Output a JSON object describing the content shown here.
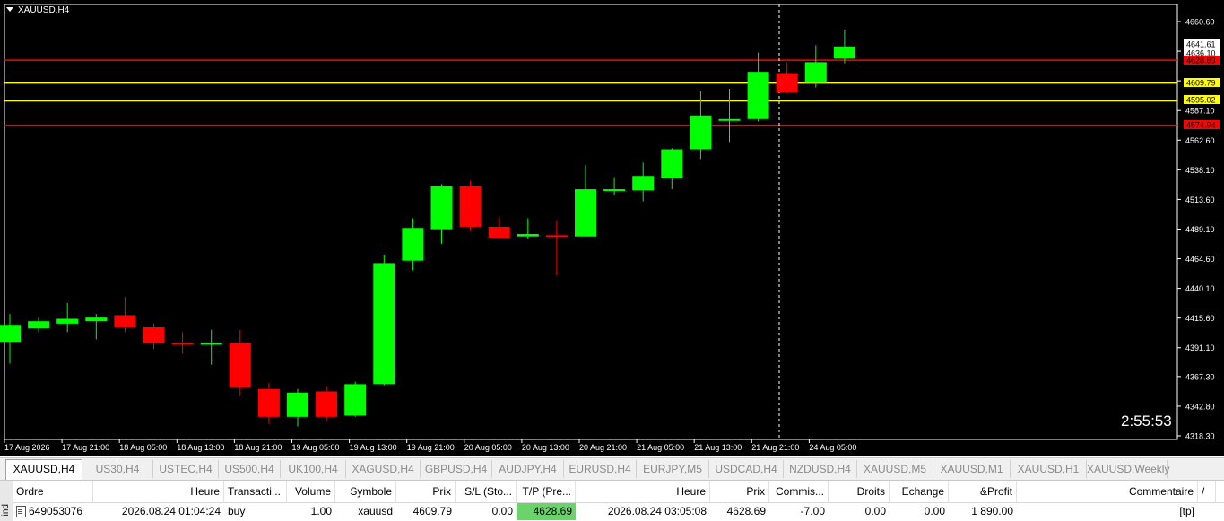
{
  "window": {
    "title": "XAUUSD,H4"
  },
  "chart_data": {
    "type": "candlestick",
    "symbol": "XAUUSD",
    "timeframe": "H4",
    "price_axis": {
      "ticks": [
        "4660.60",
        "4636.10",
        "4611.60",
        "4587.10",
        "4562.60",
        "4538.10",
        "4513.60",
        "4489.10",
        "4464.60",
        "4440.10",
        "4415.60",
        "4391.10",
        "4367.30",
        "4342.80",
        "4318.30"
      ],
      "ylim": [
        4318.3,
        4660.6
      ]
    },
    "time_axis": {
      "labels": [
        "17 Aug 2026",
        "17 Aug 21:00",
        "18 Aug 05:00",
        "18 Aug 13:00",
        "18 Aug 21:00",
        "19 Aug 05:00",
        "19 Aug 13:00",
        "19 Aug 21:00",
        "20 Aug 05:00",
        "20 Aug 13:00",
        "20 Aug 21:00",
        "21 Aug 05:00",
        "21 Aug 13:00",
        "21 Aug 21:00",
        "24 Aug 05:00"
      ]
    },
    "candles": [
      {
        "o": 4396.0,
        "h": 4419.0,
        "l": 4378.0,
        "c": 4410.0
      },
      {
        "o": 4407.0,
        "h": 4416.0,
        "l": 4404.0,
        "c": 4413.0
      },
      {
        "o": 4411.0,
        "h": 4428.0,
        "l": 4404.0,
        "c": 4415.0
      },
      {
        "o": 4413.0,
        "h": 4419.0,
        "l": 4398.0,
        "c": 4416.0
      },
      {
        "o": 4418.0,
        "h": 4433.0,
        "l": 4404.0,
        "c": 4408.0
      },
      {
        "o": 4408.0,
        "h": 4411.0,
        "l": 4390.0,
        "c": 4395.0
      },
      {
        "o": 4395.0,
        "h": 4404.0,
        "l": 4386.0,
        "c": 4394.0
      },
      {
        "o": 4394.0,
        "h": 4406.0,
        "l": 4377.0,
        "c": 4395.0
      },
      {
        "o": 4395.0,
        "h": 4406.0,
        "l": 4351.0,
        "c": 4358.0
      },
      {
        "o": 4357.0,
        "h": 4362.0,
        "l": 4328.0,
        "c": 4334.0
      },
      {
        "o": 4334.0,
        "h": 4357.0,
        "l": 4326.0,
        "c": 4354.0
      },
      {
        "o": 4355.0,
        "h": 4359.0,
        "l": 4331.0,
        "c": 4334.0
      },
      {
        "o": 4335.0,
        "h": 4363.0,
        "l": 4334.0,
        "c": 4361.0
      },
      {
        "o": 4361.0,
        "h": 4468.0,
        "l": 4360.0,
        "c": 4461.0
      },
      {
        "o": 4463.0,
        "h": 4498.0,
        "l": 4455.0,
        "c": 4490.0
      },
      {
        "o": 4489.0,
        "h": 4526.0,
        "l": 4477.0,
        "c": 4525.0
      },
      {
        "o": 4525.0,
        "h": 4529.0,
        "l": 4488.0,
        "c": 4491.0
      },
      {
        "o": 4491.0,
        "h": 4499.0,
        "l": 4482.0,
        "c": 4482.0
      },
      {
        "o": 4483.0,
        "h": 4498.0,
        "l": 4481.0,
        "c": 4485.0
      },
      {
        "o": 4484.0,
        "h": 4496.0,
        "l": 4451.0,
        "c": 4483.0
      },
      {
        "o": 4483.0,
        "h": 4542.0,
        "l": 4483.0,
        "c": 4522.0
      },
      {
        "o": 4522.0,
        "h": 4532.0,
        "l": 4517.0,
        "c": 4522.0
      },
      {
        "o": 4521.0,
        "h": 4544.0,
        "l": 4512.0,
        "c": 4533.0
      },
      {
        "o": 4531.0,
        "h": 4556.0,
        "l": 4522.0,
        "c": 4555.0
      },
      {
        "o": 4555.0,
        "h": 4603.0,
        "l": 4547.0,
        "c": 4583.0
      },
      {
        "o": 4580.0,
        "h": 4605.0,
        "l": 4561.0,
        "c": 4580.0
      },
      {
        "o": 4580.0,
        "h": 4635.0,
        "l": 4578.0,
        "c": 4619.0
      },
      {
        "o": 4618.0,
        "h": 4627.0,
        "l": 4601.0,
        "c": 4602.0
      },
      {
        "o": 4610.0,
        "h": 4641.0,
        "l": 4606.0,
        "c": 4627.0
      },
      {
        "o": 4630.0,
        "h": 4654.0,
        "l": 4626.0,
        "c": 4640.0
      }
    ],
    "price_labels": [
      {
        "value": "4641.61",
        "color": "#ffffff"
      },
      {
        "value": "4636.10",
        "color": "#ffffff"
      },
      {
        "value": "4628.69",
        "color": "#ff0000"
      },
      {
        "value": "4609.79",
        "color": "#ffff00"
      },
      {
        "value": "4595.02",
        "color": "#ffff00"
      },
      {
        "value": "4574.94",
        "color": "#ff0000"
      }
    ],
    "horizontal_lines": [
      {
        "price": 4628.69,
        "color": "#ff0000"
      },
      {
        "price": 4609.79,
        "color": "#ffff00"
      },
      {
        "price": 4595.02,
        "color": "#ffff00"
      },
      {
        "price": 4574.94,
        "color": "#ff0000"
      }
    ],
    "colors": {
      "bull": "#00ff00",
      "bear": "#ff0000",
      "background": "#000000",
      "axis": "#ffffff"
    }
  },
  "timer": "2:55:53",
  "tabs": [
    "XAUUSD,H4",
    "US30,H4",
    "USTEC,H4",
    "US500,H4",
    "UK100,H4",
    "XAGUSD,H4",
    "GBPUSD,H4",
    "AUDJPY,H4",
    "EURUSD,H4",
    "EURJPY,M5",
    "USDCAD,H4",
    "NZDUSD,H4",
    "XAUUSD,M5",
    "XAUUSD,M1",
    "XAUUSD,H1",
    "XAUUSD,Weekly"
  ],
  "terminal": {
    "side_label": "ind",
    "headers": [
      "Ordre",
      "Heure",
      "Transacti...",
      "Volume",
      "Symbole",
      "Prix",
      "S/L (Sto...",
      "T/P (Pre...",
      "Heure",
      "Prix",
      "Commis...",
      "Droits",
      "Echange",
      "&Profit",
      "Commentaire",
      "/"
    ],
    "row": [
      "649053076",
      "2026.08.24 01:04:24",
      "buy",
      "1.00",
      "xauusd",
      "4609.79",
      "0.00",
      "4628.69",
      "2026.08.24 03:05:08",
      "4628.69",
      "-7.00",
      "0.00",
      "0.00",
      "1 890.00",
      "[tp]"
    ]
  }
}
